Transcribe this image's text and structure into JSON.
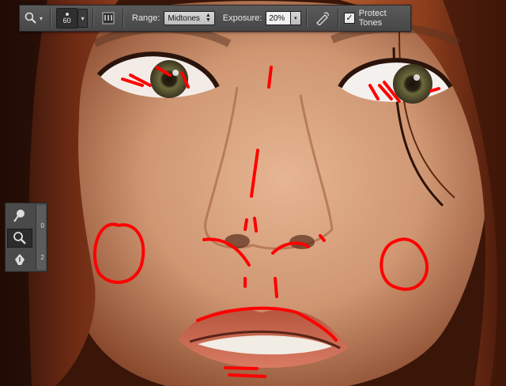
{
  "options_bar": {
    "brush_size": "60",
    "range_label": "Range:",
    "range_value": "Midtones",
    "exposure_label": "Exposure:",
    "exposure_value": "20%",
    "protect_tones_label": "Protect Tones",
    "protect_tones_checked": true
  },
  "tool_panel": {
    "tools": [
      "dodge-tool",
      "burn-tool",
      "pen-tool"
    ],
    "active_tool": "burn-tool",
    "ruler_marks": [
      "0",
      "2"
    ]
  },
  "colors": {
    "markup_red": "#ff0000",
    "toolbar_bg": "#4a4a4a"
  }
}
